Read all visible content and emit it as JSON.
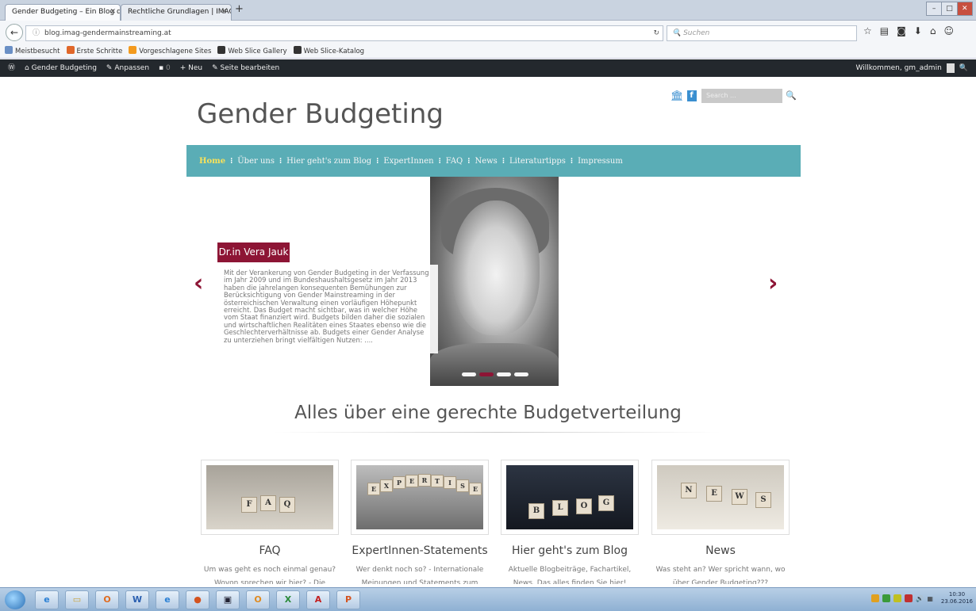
{
  "browser": {
    "tabs": [
      {
        "label": "Gender Budgeting – Ein Blog d...",
        "active": true
      },
      {
        "label": "Rechtliche Grundlagen | IMAG ...",
        "active": false
      }
    ],
    "url": "blog.imag-gendermainstreaming.at",
    "search_placeholder": "Suchen",
    "bookmarks": [
      "Meistbesucht",
      "Erste Schritte",
      "Vorgeschlagene Sites",
      "Web Slice Gallery",
      "Web Slice-Katalog"
    ]
  },
  "adminbar": {
    "site": "Gender Budgeting",
    "customize": "Anpassen",
    "comments": "0",
    "new": "Neu",
    "edit": "Seite bearbeiten",
    "greeting": "Willkommen, gm_admin"
  },
  "site": {
    "title": "Gender Budgeting",
    "search_placeholder": "Search ..."
  },
  "nav": {
    "items": [
      "Home",
      "Über uns",
      "Hier geht's zum Blog",
      "ExpertInnen",
      "FAQ",
      "News",
      "Literaturtipps",
      "Impressum"
    ],
    "active": "Home"
  },
  "slider": {
    "name": "Dr.in Vera Jauk",
    "text": "Mit der Verankerung von Gender Budgeting in der Verfassung im Jahr 2009 und im Bundeshaushaltsgesetz im Jahr 2013 haben die jahrelangen konsequenten Bemühungen zur Berücksichtigung von Gender Mainstreaming in der österreichischen Verwaltung einen vorläufigen Höhepunkt erreicht. Das Budget macht sichtbar, was in welcher Höhe vom Staat finanziert wird. Budgets bilden daher die sozialen und wirtschaftlichen Realitäten eines Staates ebenso wie die Geschlechterverhältnisse ab. Budgets einer Gender Analyse zu unterziehen bringt vielfältigen Nutzen: ....",
    "active_dot": 2,
    "dot_count": 4
  },
  "section": {
    "title": "Alles über eine gerechte Budgetverteilung"
  },
  "cards": [
    {
      "title": "FAQ",
      "desc": "Um was geht es noch einmal genau? Wovon sprechen wir hier? - Die",
      "cubes": [
        "F",
        "A",
        "Q"
      ]
    },
    {
      "title": "ExpertInnen-Statements",
      "desc": "Wer denkt noch so? - Internationale Meinungen und Statements zum",
      "cubes": [
        "E",
        "X",
        "P",
        "E",
        "R",
        "T",
        "I",
        "S",
        "E"
      ]
    },
    {
      "title": "Hier geht's zum Blog",
      "desc": "Aktuelle Blogbeiträge, Fachartikel, News. Das alles finden Sie hier!",
      "cubes": [
        "B",
        "L",
        "O",
        "G"
      ]
    },
    {
      "title": "News",
      "desc": "Was steht an? Wer spricht wann, wo über Gender Budgeting???",
      "cubes": [
        "N",
        "E",
        "W",
        "S"
      ]
    }
  ],
  "taskbar": {
    "time": "10:30",
    "date": "23.06.2016"
  },
  "colors": {
    "accent": "#8d1535",
    "nav_bg": "#5aadb6",
    "nav_active": "#f8e25a"
  }
}
